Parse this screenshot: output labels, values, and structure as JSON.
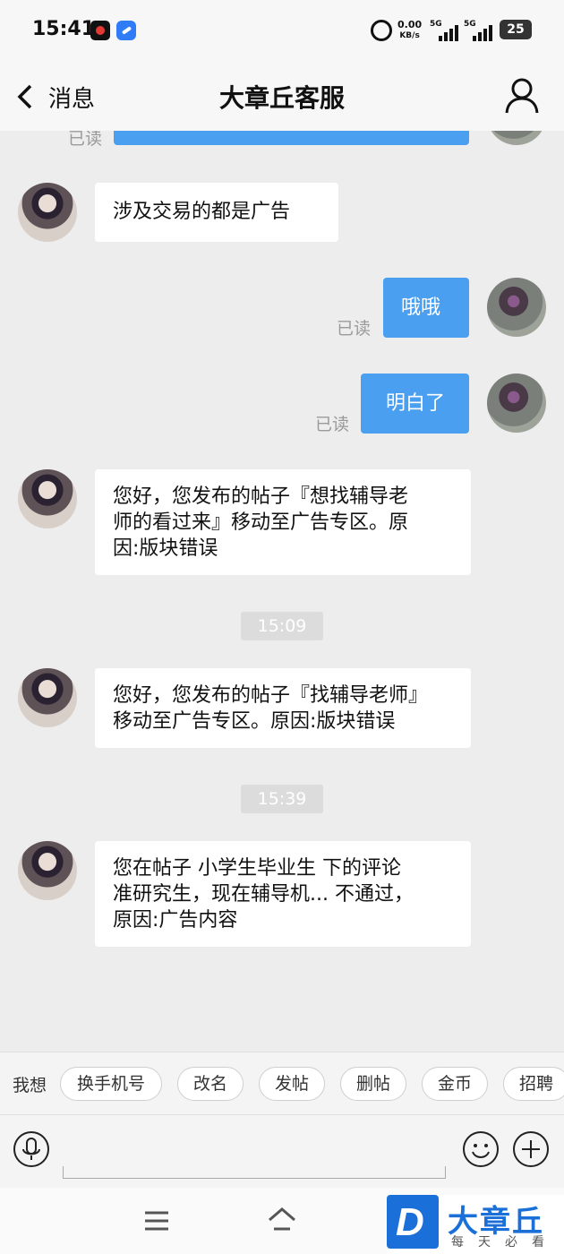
{
  "status_bar": {
    "time": "15:41",
    "net_speed_value": "0.00",
    "net_speed_unit": "KB/s",
    "signal1_label": "5G",
    "signal2_label": "5G",
    "battery": "25"
  },
  "header": {
    "back_label": "消息",
    "title": "大章丘客服"
  },
  "chat": {
    "read_label": "已读",
    "messages": [
      {
        "from": "agent",
        "text": "涉及交易的都是广告"
      },
      {
        "from": "me",
        "text": "哦哦",
        "status": "已读"
      },
      {
        "from": "me",
        "text": "明白了",
        "status": "已读"
      },
      {
        "from": "agent",
        "lines": [
          "您好，您发布的帖子『想找辅导老",
          "师的看过来』移动至广告专区。原",
          "因:版块错误"
        ]
      },
      {
        "from": "agent",
        "lines": [
          "您好，您发布的帖子『找辅导老师』",
          "移动至广告专区。原因:版块错误"
        ]
      },
      {
        "from": "agent",
        "lines": [
          "您在帖子 小学生毕业生 下的评论",
          "准研究生，现在辅导机... 不通过，",
          "原因:广告内容"
        ]
      }
    ],
    "timestamps": [
      "15:09",
      "15:39"
    ]
  },
  "quick_bar": {
    "label": "我想",
    "chips": [
      "换手机号",
      "改名",
      "发帖",
      "删帖",
      "金币",
      "招聘"
    ]
  },
  "watermark": {
    "letter": "D",
    "name": "大章丘",
    "slogan": "每天必看"
  },
  "colors": {
    "accent": "#4a9ff0",
    "background": "#ededed",
    "watermark_blue": "#1a6fd8"
  }
}
